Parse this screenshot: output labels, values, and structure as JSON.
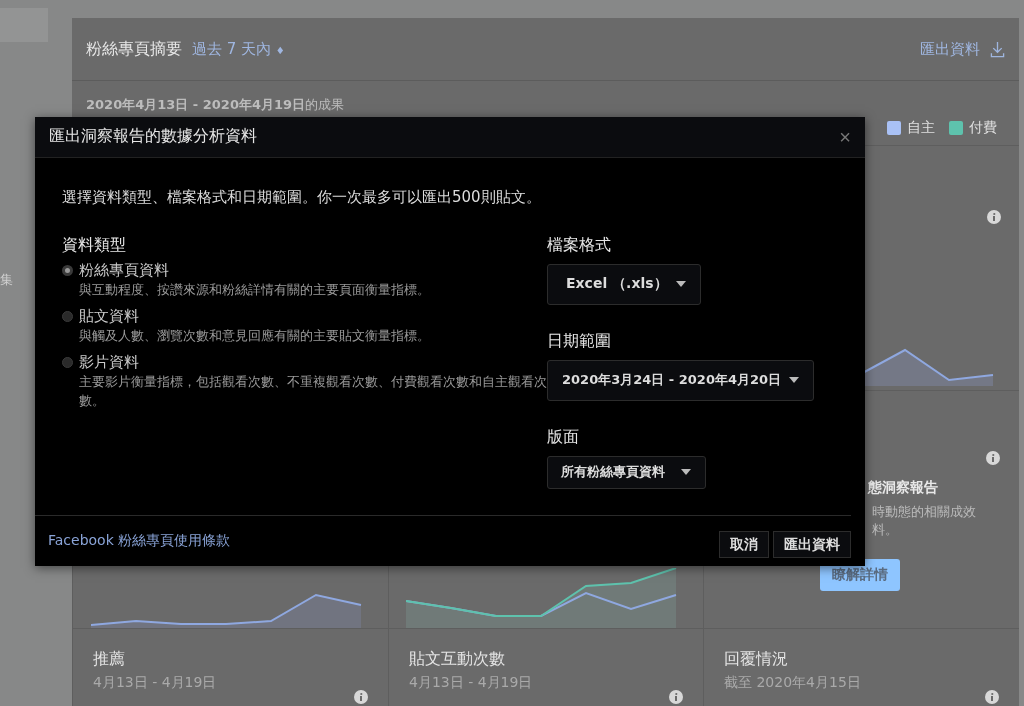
{
  "sidebar": {
    "label": "集"
  },
  "summary": {
    "title": "粉絲專頁摘要",
    "period": "過去 7 天內",
    "period_caret": "♦",
    "export_link": "匯出資料",
    "results_caption": "**2020年4月13日 - 2020年4月19日**的成果",
    "legend": [
      {
        "label": "自主",
        "color": "#a9c1f5"
      },
      {
        "label": "付費",
        "color": "#5ec2ad"
      }
    ]
  },
  "promo_card": {
    "title": "態洞察報告",
    "description_lines": [
      "時動態的相關成效",
      "料。"
    ],
    "button": "瞭解詳情"
  },
  "metric_cards": [
    {
      "title": "推薦",
      "date": "4月13日 - 4月19日"
    },
    {
      "title": "貼文互動次數",
      "date": "4月13日 - 4月19日"
    },
    {
      "title": "回覆情況",
      "date": "截至 2020年4月15日"
    }
  ],
  "dialog": {
    "title": "匯出洞察報告的數據分析資料",
    "close": "×",
    "intro": "選擇資料類型、檔案格式和日期範圍。你一次最多可以匯出500則貼文。",
    "data_type_label": "資料類型",
    "data_types": [
      {
        "label": "粉絲專頁資料",
        "description": "與互動程度、按讚來源和粉絲詳情有關的主要頁面衡量指標。",
        "selected": true
      },
      {
        "label": "貼文資料",
        "description": "與觸及人數、瀏覽次數和意見回應有關的主要貼文衡量指標。",
        "selected": false
      },
      {
        "label": "影片資料",
        "description": "主要影片衡量指標，包括觀看次數、不重複觀看次數、付費觀看次數和自主觀看次數。",
        "selected": false
      }
    ],
    "file_format_label": "檔案格式",
    "file_format": "Excel （.xls）",
    "date_range_label": "日期範圍",
    "date_range": "2020年3月24日 - 2020年4月20日",
    "layout_label": "版面",
    "layout": "所有粉絲專頁資料",
    "terms_link": "Facebook 粉絲專頁使用條款",
    "buttons": [
      "取消",
      "匯出資料"
    ]
  }
}
